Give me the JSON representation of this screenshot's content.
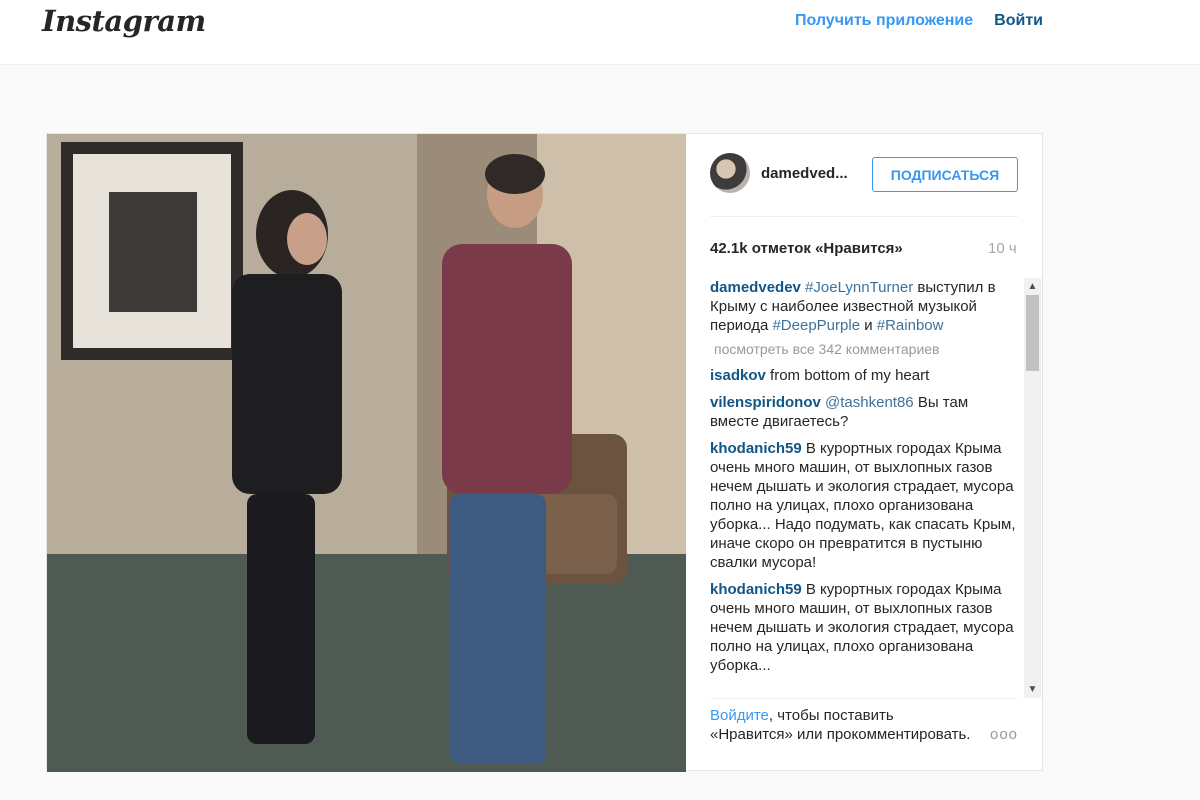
{
  "header": {
    "logo": "Instagram",
    "get_app": "Получить приложение",
    "login": "Войти"
  },
  "post": {
    "author": "damedved...",
    "follow_label": "ПОДПИСАТЬСЯ",
    "likes": "42.1k отметок «Нравится»",
    "time": "10 ч",
    "caption": {
      "user": "damedvedev",
      "tag1": "#JoeLynnTurner",
      "text1": " выступил в Крыму с наиболее известной музыкой периода ",
      "tag2": "#DeepPurple",
      "text2": " и ",
      "tag3": "#Rainbow"
    },
    "view_all": "посмотреть все 342 комментариев",
    "comments": [
      {
        "user": "isadkov",
        "mention": "",
        "text": "from bottom of my heart"
      },
      {
        "user": "vilenspiridonov",
        "mention": "@tashkent86",
        "text": "Вы там вместе двигаетесь?"
      },
      {
        "user": "khodanich59",
        "mention": "",
        "text": "В курортных городах Крыма очень много машин, от выхлопных газов нечем дышать и экология страдает, мусора полно на улицах, плохо организована уборка... Надо подумать, как спасать Крым, иначе скоро он превратится в пустыню свалки мусора!"
      },
      {
        "user": "khodanich59",
        "mention": "",
        "text": "В курортных городах Крыма очень много машин, от выхлопных газов нечем дышать и экология страдает, мусора полно на улицах, плохо организована уборка..."
      }
    ],
    "footer": {
      "login_link": "Войдите",
      "text": ", чтобы поставить «Нравится» или прокомментировать."
    },
    "more": "ооо"
  },
  "icons": {
    "scroll_up": "up-arrow",
    "scroll_down": "down-arrow"
  }
}
